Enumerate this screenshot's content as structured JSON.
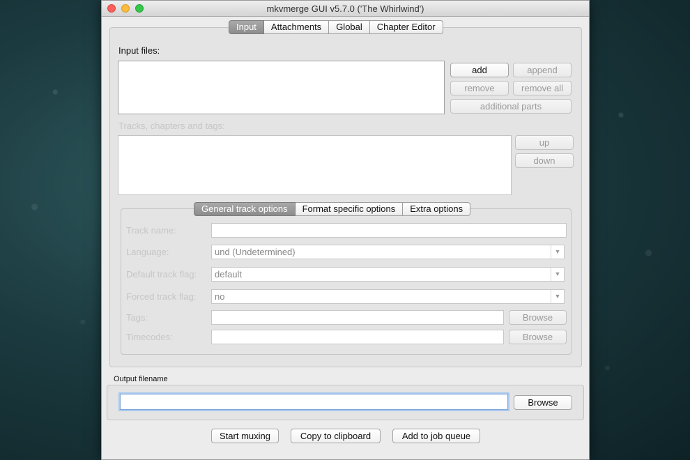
{
  "window": {
    "title": "mkvmerge GUI v5.7.0 ('The Whirlwind')"
  },
  "main_tabs": [
    "Input",
    "Attachments",
    "Global",
    "Chapter Editor"
  ],
  "input": {
    "input_files_label": "Input files:",
    "buttons": {
      "add": "add",
      "append": "append",
      "remove": "remove",
      "remove_all": "remove all",
      "additional_parts": "additional parts"
    },
    "tracks_label": "Tracks, chapters and tags:",
    "track_buttons": {
      "up": "up",
      "down": "down"
    }
  },
  "track_tabs": [
    "General track options",
    "Format specific options",
    "Extra options"
  ],
  "track_options": {
    "track_name_label": "Track name:",
    "track_name_value": "",
    "language_label": "Language:",
    "language_value": "und (Undetermined)",
    "default_flag_label": "Default track flag:",
    "default_flag_value": "default",
    "forced_flag_label": "Forced track flag:",
    "forced_flag_value": "no",
    "tags_label": "Tags:",
    "tags_value": "",
    "timecodes_label": "Timecodes:",
    "timecodes_value": "",
    "browse_label": "Browse"
  },
  "output": {
    "label": "Output filename",
    "value": "",
    "browse_label": "Browse"
  },
  "actions": {
    "start": "Start muxing",
    "copy": "Copy to clipboard",
    "queue": "Add to job queue"
  },
  "icons": {
    "dropdown": "chevron-down-icon"
  }
}
